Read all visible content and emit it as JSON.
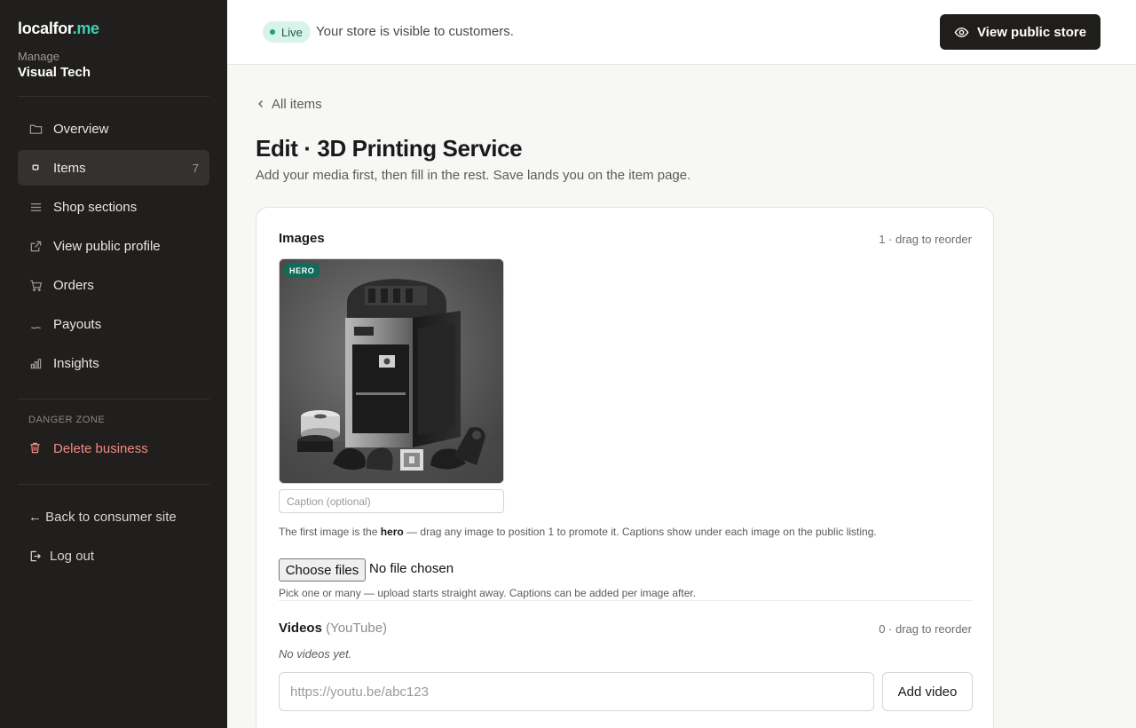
{
  "brand": {
    "name": "localfor",
    "tld": ".me"
  },
  "sidebar": {
    "manage_label": "Manage",
    "business_name": "Visual Tech",
    "items": [
      {
        "label": "Overview",
        "icon": "folder-icon"
      },
      {
        "label": "Items",
        "icon": "box-icon",
        "count": "7",
        "active": true
      },
      {
        "label": "Shop sections",
        "icon": "list-icon"
      },
      {
        "label": "View public profile",
        "icon": "external-link-icon"
      },
      {
        "label": "Orders",
        "icon": "cart-icon"
      },
      {
        "label": "Payouts",
        "icon": "payout-icon"
      },
      {
        "label": "Insights",
        "icon": "bar-chart-icon"
      }
    ],
    "danger_label": "DANGER ZONE",
    "delete_label": "Delete business",
    "back_label": "← Back to consumer site",
    "logout_label": "Log out"
  },
  "topbar": {
    "status_badge": "Live",
    "status_text": "Your store is visible to customers.",
    "view_store_label": "View public store"
  },
  "main": {
    "back_link": "All items",
    "title": "Edit · 3D Printing Service",
    "subtitle": "Add your media first, then fill in the rest. Save lands you on the item page.",
    "images": {
      "title": "Images",
      "meta": "1 · drag to reorder",
      "hero_badge": "HERO",
      "caption_placeholder": "Caption (optional)",
      "help_pre": "The first image is the ",
      "help_bold": "hero",
      "help_post": " — drag any image to position 1 to promote it. Captions show under each image on the public listing.",
      "file_button": "Choose files",
      "file_status": "No file chosen",
      "file_help": "Pick one or many — upload starts straight away. Captions can be added per image after."
    },
    "videos": {
      "title": "Videos",
      "title_suffix": "(YouTube)",
      "meta": "0 · drag to reorder",
      "empty_text": "No videos yet.",
      "url_placeholder": "https://youtu.be/abc123",
      "add_label": "Add video"
    }
  },
  "colors": {
    "sidebar_bg": "#201f1d",
    "accent": "#3fd0b4",
    "live_badge_bg": "#d8f3e9",
    "danger": "#f08a82",
    "hero_badge_bg": "#0f6b5a",
    "primary_button": "#1f1e1c"
  }
}
